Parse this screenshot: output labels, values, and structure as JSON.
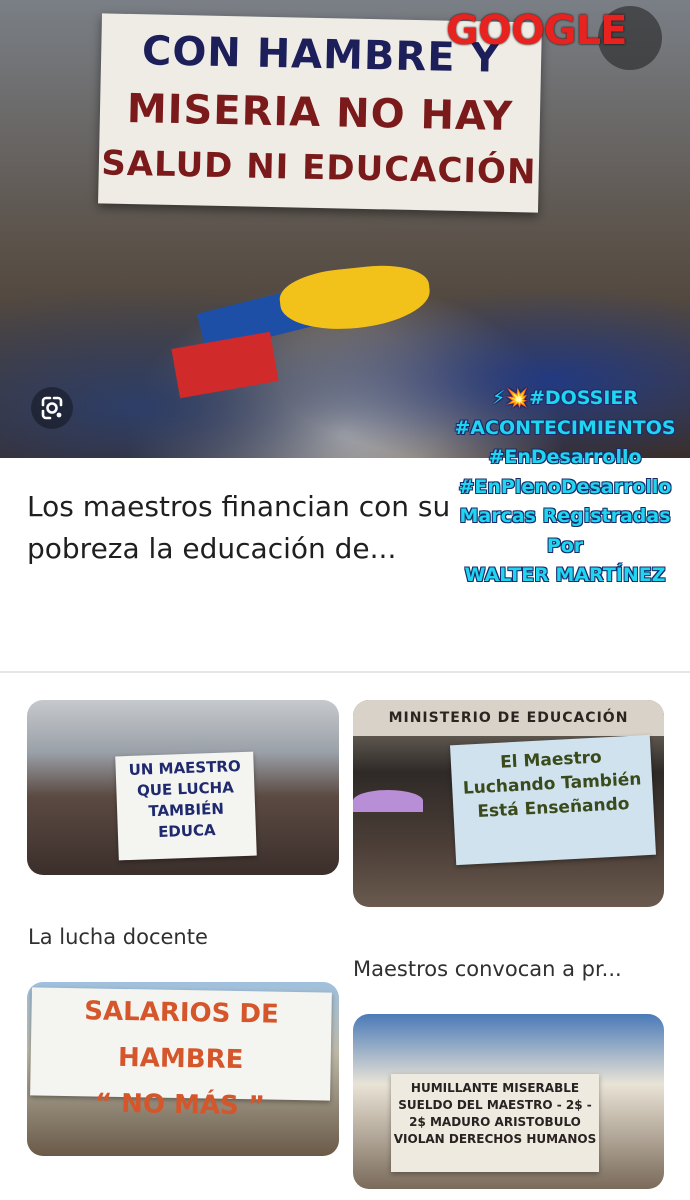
{
  "hero": {
    "sign_lines": [
      "CON HAMBRE Y",
      "MISERIA NO HAY",
      "SALUD NI EDUCACIÓN"
    ],
    "brand_label": "GOOGLE",
    "lens_icon": "google-lens-icon"
  },
  "overlay": {
    "line1": "⚡💥#DOSSIER",
    "line2": "#ACONTECIMIENTOS",
    "line3": "#EnDesarrollo",
    "line4": "#EnPlenoDesarrollo",
    "line5": "Marcas Registradas",
    "line6": "Por",
    "line7": "WALTER MARTÍNEZ"
  },
  "article": {
    "title": "Los maestros financian con su pobreza la educación de..."
  },
  "grid": {
    "cards": [
      {
        "sign": "UN MAESTRO QUE LUCHA TAMBIÉN EDUCA",
        "label": "La lucha docente"
      },
      {
        "building": "MINISTERIO DE EDUCACIÓN",
        "sign": "El Maestro Luchando También Está Enseñando",
        "label": "Maestros convocan a pr..."
      },
      {
        "sign_line1": "SALARIOS DE HAMBRE",
        "sign_line2": "“ NO MÁS ”"
      },
      {
        "sign": "HUMILLANTE MISERABLE SUELDO DEL MAESTRO - 2$ - 2$ MADURO ARISTOBULO VIOLAN DERECHOS HUMANOS"
      }
    ]
  },
  "colors": {
    "brand_red": "#e8231f",
    "overlay_cyan": "#1fd6f0",
    "title_text": "#1f1f1f"
  }
}
